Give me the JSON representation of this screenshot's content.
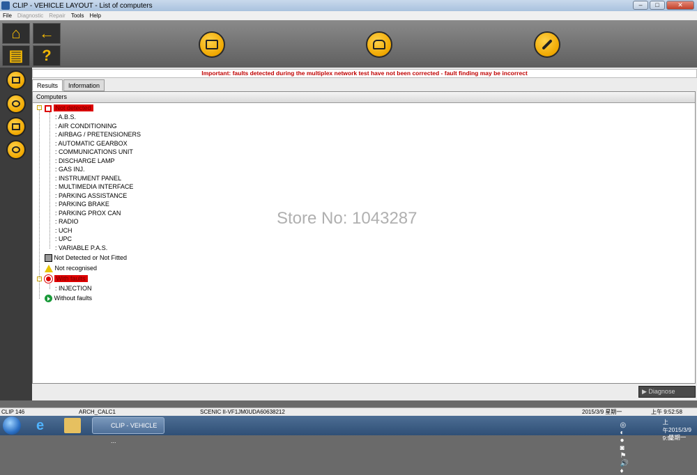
{
  "window": {
    "title": "CLIP - VEHICLE LAYOUT - List of computers"
  },
  "menu": {
    "items": [
      "File",
      "Diagnostic",
      "Repair",
      "Tools",
      "Help"
    ]
  },
  "topbar": {
    "home_icon": "home-icon",
    "back_icon": "arrow-left-icon",
    "print_icon": "printer-icon",
    "help_icon": "question-icon",
    "buttons": [
      "checklist-icon",
      "vehicle-icon",
      "wrench-icon"
    ]
  },
  "sidebar": {
    "buttons": [
      "ecu-icon",
      "settings-icon",
      "document-icon",
      "network-icon"
    ]
  },
  "warning": "Important: faults detected during the multiplex network test have not been corrected - fault finding may be incorrect",
  "tabs": [
    "Results",
    "Information"
  ],
  "column_header": "Computers",
  "tree": {
    "not_detected": {
      "label": "Not detected",
      "children": [
        ": A.B.S.",
        ": AIR CONDITIONING",
        ": AIRBAG / PRETENSIONERS",
        ": AUTOMATIC GEARBOX",
        ": COMMUNICATIONS UNIT",
        ": DISCHARGE LAMP",
        ": GAS INJ.",
        ": INSTRUMENT PANEL",
        ": MULTIMEDIA INTERFACE",
        ": PARKING ASSISTANCE",
        ": PARKING BRAKE",
        ": PARKING PROX CAN",
        ": RADIO",
        ": UCH",
        ": UPC",
        ": VARIABLE P.A.S."
      ]
    },
    "not_fitted": "Not Detected or Not Fitted",
    "not_recognised": "Not recognised",
    "with_faults": {
      "label": "With faults",
      "children": [
        ": INJECTION"
      ]
    },
    "without_faults": "Without faults"
  },
  "watermark": "Store No: 1043287",
  "diagnose_button": "Diagnose",
  "status": {
    "clip": "CLIP 146",
    "arch": "ARCH_CALC1",
    "vehicle": "SCENIC II-VF1JM0UDA60638212",
    "date": "2015/3/9 星期一",
    "time": "上午 9:52:58"
  },
  "taskbar": {
    "task_label": "CLIP - VEHICLE ...",
    "clock_time": "上午 9:52",
    "clock_date": "2015/3/9 星期一"
  }
}
